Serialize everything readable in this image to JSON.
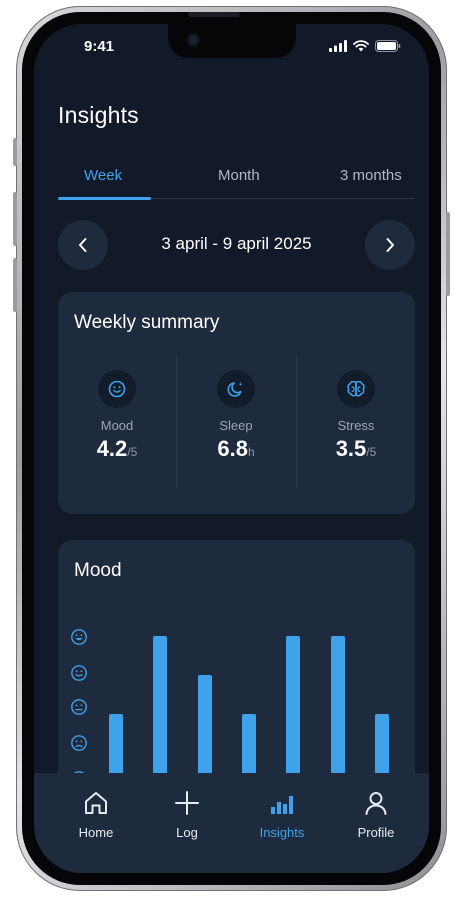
{
  "status_bar": {
    "time": "9:41"
  },
  "header": {
    "title": "Insights"
  },
  "tabs": [
    {
      "label": "Week",
      "active": true
    },
    {
      "label": "Month",
      "active": false
    },
    {
      "label": "3 months",
      "active": false
    }
  ],
  "date_range": {
    "label": "3 april - 9 april 2025",
    "prev_icon": "chevron-left-icon",
    "next_icon": "chevron-right-icon"
  },
  "weekly_summary": {
    "title": "Weekly summary",
    "metrics": [
      {
        "label": "Mood",
        "value": "4.2",
        "unit": "/5",
        "icon": "smiley-icon"
      },
      {
        "label": "Sleep",
        "value": "6.8",
        "unit": "h",
        "icon": "moon-icon"
      },
      {
        "label": "Stress",
        "value": "3.5",
        "unit": "/5",
        "icon": "brain-icon"
      }
    ]
  },
  "mood_card": {
    "title": "Mood",
    "scale_icons": [
      "very-happy-face-icon",
      "happy-face-icon",
      "neutral-face-icon",
      "sad-face-icon",
      "very-sad-face-icon"
    ]
  },
  "chart_data": {
    "type": "bar",
    "categories": [
      "",
      "",
      "",
      "",
      "",
      "",
      ""
    ],
    "values": [
      4.0,
      5.0,
      4.5,
      4.0,
      5.0,
      5.0,
      4.0
    ],
    "title": "Mood",
    "xlabel": "",
    "ylabel": "",
    "ylim": [
      0,
      5
    ],
    "color": "#3fa2ea",
    "grid": false
  },
  "bottom_nav": [
    {
      "label": "Home",
      "icon": "home-icon",
      "active": false
    },
    {
      "label": "Log",
      "icon": "plus-icon",
      "active": false
    },
    {
      "label": "Insights",
      "icon": "bar-chart-icon",
      "active": true
    },
    {
      "label": "Profile",
      "icon": "user-icon",
      "active": false
    }
  ],
  "colors": {
    "accent": "#3fa2ea",
    "background": "#121a29",
    "card": "#1e2a3d"
  }
}
